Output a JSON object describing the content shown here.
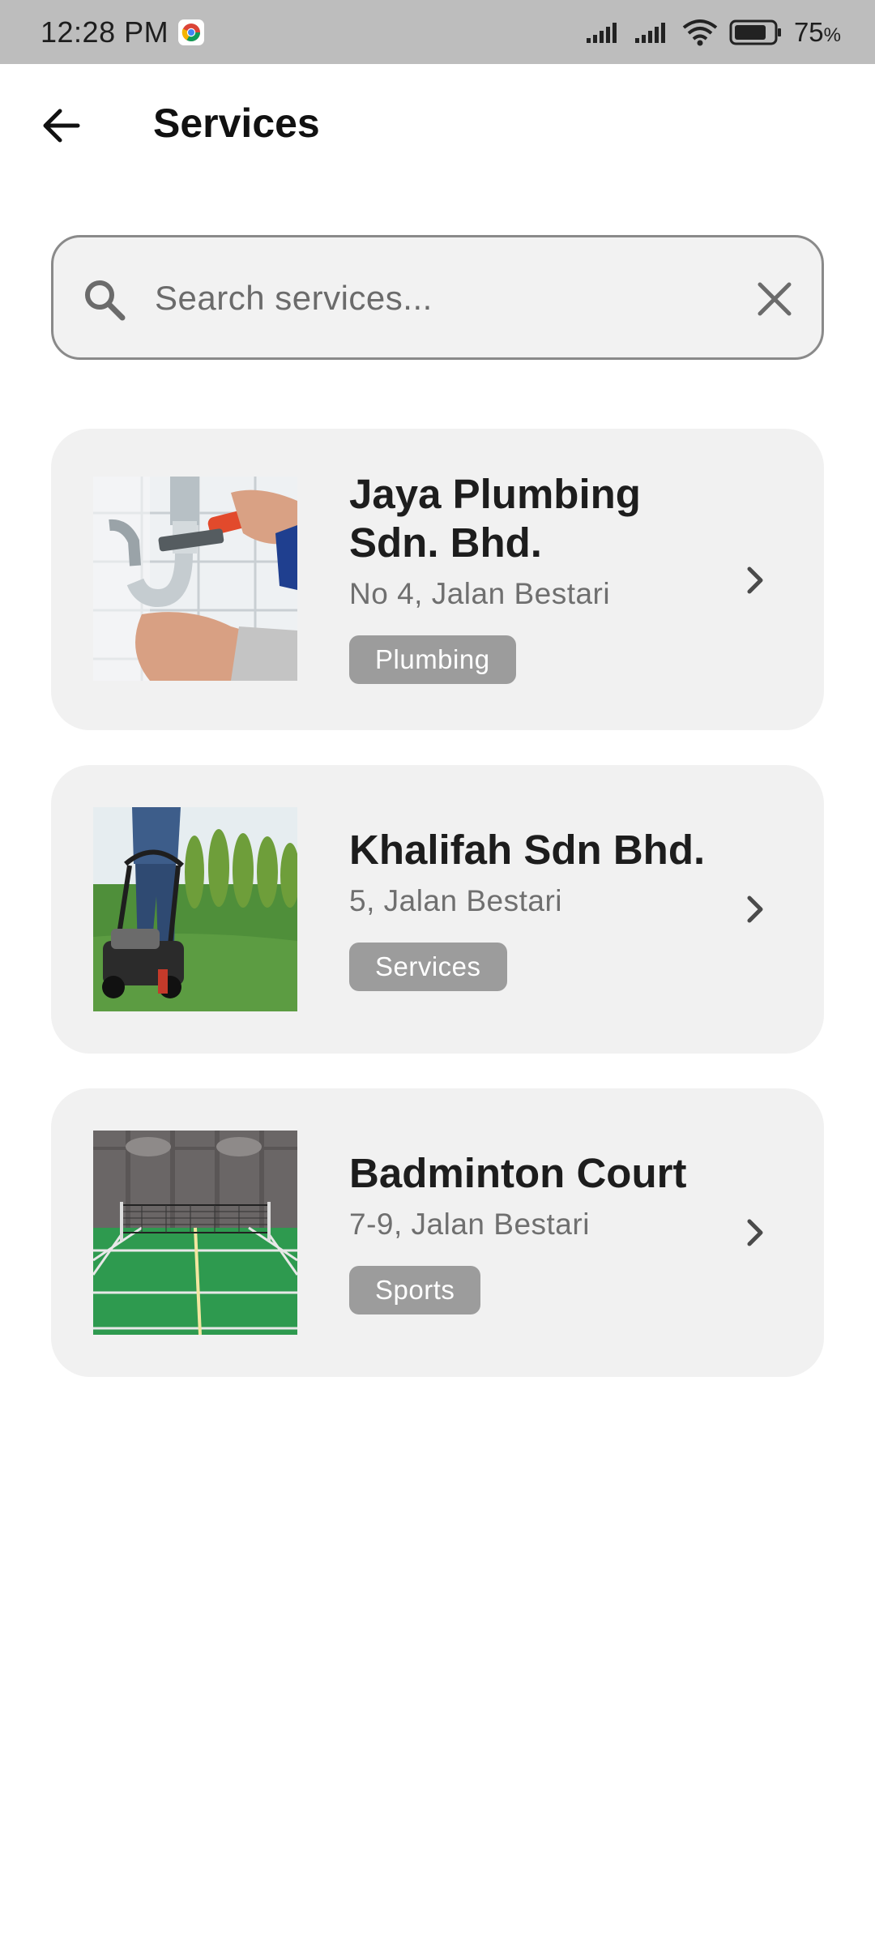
{
  "status_bar": {
    "time": "12:28 PM",
    "battery_value": "75",
    "battery_unit": "%",
    "icons": [
      "chrome-icon",
      "signal-icon",
      "signal-icon",
      "wifi-icon",
      "battery-icon"
    ]
  },
  "header": {
    "title": "Services",
    "back_icon": "arrow-left-icon"
  },
  "search": {
    "placeholder": "Search services...",
    "value": ""
  },
  "services": [
    {
      "name_line1": "Jaya Plumbing",
      "name_line2": "Sdn. Bhd.",
      "address": "No 4, Jalan Bestari",
      "tag": "Plumbing",
      "image": "plumbing-photo"
    },
    {
      "name": "Khalifah Sdn Bhd.",
      "address": "5, Jalan Bestari",
      "tag": "Services",
      "image": "lawn-mower-photo"
    },
    {
      "name": "Badminton Court",
      "address": "7-9, Jalan Bestari",
      "tag": "Sports",
      "image": "badminton-court-photo"
    }
  ],
  "colors": {
    "status_bar": "#bdbdbd",
    "card_bg": "#f1f1f1",
    "tag_bg": "#9c9c9c",
    "search_border": "#8a8a8a"
  }
}
